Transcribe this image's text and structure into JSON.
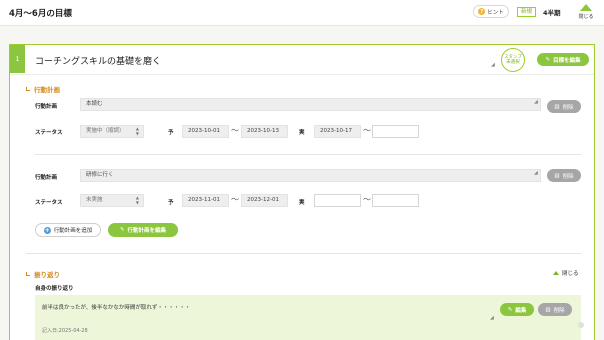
{
  "header": {
    "title": "4月〜6月の目標",
    "hint_label": "ヒント",
    "hint_icon": "?",
    "new_badge": "新規",
    "quarter": "4半期",
    "close_label": "閉じる"
  },
  "goal": {
    "number": "1",
    "title": "コーチングスキルの基礎を磨く",
    "stamp_label": "スタンプ未選択",
    "edit_label": "目標を編集"
  },
  "action_plan": {
    "section_title": "行動計画",
    "plan_label": "行動計画",
    "status_label": "ステータス",
    "planned_mark": "予",
    "actual_mark": "実",
    "tilde": "〜",
    "delete_label": "削除",
    "items": [
      {
        "plan": "本読む",
        "status": "実施中（順調）",
        "plan_start": "2023-10-01",
        "plan_end": "2023-10-13",
        "actual_start": "2023-10-17",
        "actual_end": ""
      },
      {
        "plan": "研修に行く",
        "status": "未実施",
        "plan_start": "2023-11-01",
        "plan_end": "2023-12-01",
        "actual_start": "",
        "actual_end": ""
      }
    ],
    "add_label": "行動計画を追加",
    "edit_label": "行動計画を編集"
  },
  "reflection": {
    "section_title": "振り返り",
    "collapse_label": "閉じる",
    "self_label": "自身の振り返り",
    "text": "前半は良かったが、後半なかなか時間が取れず・・・・・・",
    "date": "記入日:2025-04-28",
    "edit_label": "編集",
    "delete_label": "削除"
  },
  "colors": {
    "accent": "#8cc63f",
    "section_head": "#d58a1e",
    "reflection_bg": "#eef6d9"
  }
}
